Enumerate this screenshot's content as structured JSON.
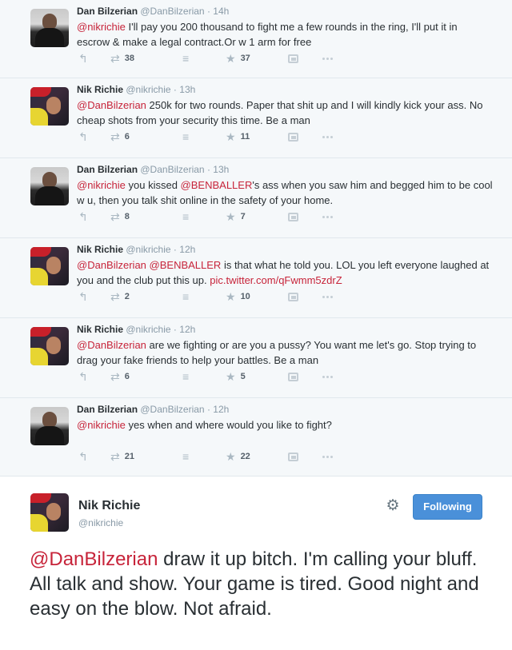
{
  "colors": {
    "link": "#c7243a",
    "follow_button": "#4a90d9",
    "thread_bg": "#f5f8fa"
  },
  "icons": [
    "reply-icon",
    "retweet-icon",
    "stack-icon",
    "favorite-icon",
    "image-icon",
    "more-icon",
    "gear-icon"
  ],
  "tweets": [
    {
      "name": "Dan Bilzerian",
      "handle": "@DanBilzerian",
      "sep": "·",
      "time": "14h",
      "mention": "@nikrichie",
      "text_after": " I'll pay you 200 thousand to fight me a few rounds in the ring, I'll put it in escrow & make a legal contract.Or w 1 arm for free",
      "retweets": "38",
      "favorites": "37"
    },
    {
      "name": "Nik Richie",
      "handle": "@nikrichie",
      "sep": "·",
      "time": "13h",
      "mention": "@DanBilzerian",
      "text_after": " 250k for two rounds. Paper that shit up and I will kindly kick your ass. No cheap shots from your security this time. Be a man",
      "retweets": "6",
      "favorites": "11"
    },
    {
      "name": "Dan Bilzerian",
      "handle": "@DanBilzerian",
      "sep": "·",
      "time": "13h",
      "mention": "@nikrichie",
      "text_mid": " you kissed ",
      "mention2": "@BENBALLER",
      "text_after": "'s ass when you saw him and begged him to be cool w u, then you talk shit online in the safety of your home.",
      "retweets": "8",
      "favorites": "7"
    },
    {
      "name": "Nik Richie",
      "handle": "@nikrichie",
      "sep": "·",
      "time": "12h",
      "mention": "@DanBilzerian",
      "mention2": "@BENBALLER",
      "text_after": " is that what he told you. LOL you left everyone laughed at you and the club put this up. ",
      "link": "pic.twitter.com/qFwmm5zdrZ",
      "retweets": "2",
      "favorites": "10"
    },
    {
      "name": "Nik Richie",
      "handle": "@nikrichie",
      "sep": "·",
      "time": "12h",
      "mention": "@DanBilzerian",
      "text_after": " are we fighting or are you a pussy? You want me let's go. Stop trying to drag your fake friends to help your battles. Be a man",
      "retweets": "6",
      "favorites": "5"
    },
    {
      "name": "Dan Bilzerian",
      "handle": "@DanBilzerian",
      "sep": "·",
      "time": "12h",
      "mention": "@nikrichie",
      "text_after": " yes when and where would you like to fight?",
      "retweets": "21",
      "favorites": "22"
    }
  ],
  "main_tweet": {
    "name": "Nik Richie",
    "handle": "@nikrichie",
    "follow_label": "Following",
    "mention": "@DanBilzerian",
    "text_after": " draw it up bitch. I'm calling your bluff. All talk and show. Your game is tired. Good night and easy on the blow. Not afraid."
  }
}
